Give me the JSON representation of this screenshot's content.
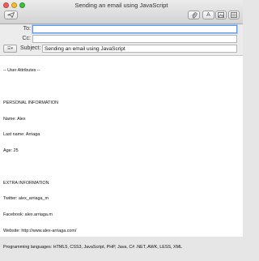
{
  "window": {
    "title": "Sending an email using JavaScript"
  },
  "toolbar": {
    "send_icon": "send-icon",
    "attach_icon": "paperclip-icon",
    "format_label": "A",
    "photo_icon": "photo-browser-icon",
    "template_icon": "stationery-icon"
  },
  "fields": {
    "to_label": "To:",
    "to_value": "",
    "cc_label": "Cc:",
    "cc_value": "",
    "subject_label": "Subject:",
    "subject_value": "Sending an email using JavaScript"
  },
  "body": {
    "lines": [
      "-- User Attributes --",
      "",
      "PERSONAL INFORMATION",
      "Name: Alex",
      "Last name: Arriaga",
      "Age: 25",
      "",
      "EXTRA INFORMATION",
      "Twitter: alex_arriaga_m",
      "Facebook: alex.arriaga.m",
      "Website: http://www.alex-arriaga.com/",
      "Programming languages: HTML5, CSS3, JavaScript, PHP, Java, C# .NET, AWK, LESS, XML"
    ]
  }
}
